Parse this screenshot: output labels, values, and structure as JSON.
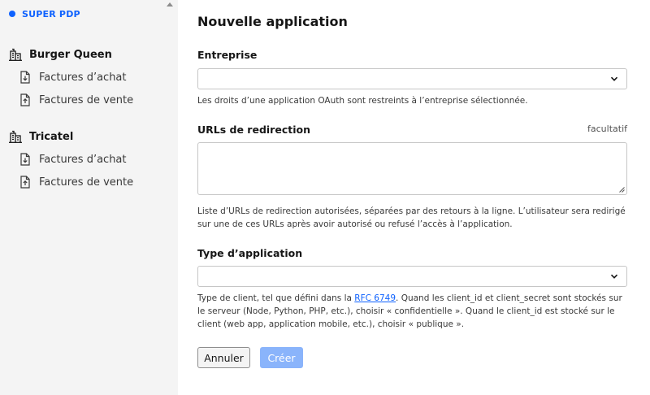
{
  "sidebar": {
    "brand": "SUPER PDP",
    "companies": [
      {
        "name": "Burger Queen",
        "icon": "building-icon",
        "items": [
          {
            "label": "Factures d’achat",
            "icon": "document-download-icon"
          },
          {
            "label": "Factures de vente",
            "icon": "document-upload-icon"
          }
        ]
      },
      {
        "name": "Tricatel",
        "icon": "building-icon",
        "items": [
          {
            "label": "Factures d’achat",
            "icon": "document-download-icon"
          },
          {
            "label": "Factures de vente",
            "icon": "document-upload-icon"
          }
        ]
      }
    ]
  },
  "form": {
    "title": "Nouvelle application",
    "company": {
      "label": "Entreprise",
      "value": "",
      "help": "Les droits d’une application OAuth sont restreints à l’entreprise sélectionnée."
    },
    "redirect_urls": {
      "label": "URLs de redirection",
      "optional": "facultatif",
      "value": "",
      "help": "Liste d’URLs de redirection autorisées, séparées par des retours à la ligne. L’utilisateur sera redirigé sur une de ces URLs après avoir autorisé ou refusé l’accès à l’application."
    },
    "app_type": {
      "label": "Type d’application",
      "value": "",
      "help_before": "Type de client, tel que défini dans la ",
      "help_link": "RFC 6749",
      "help_after": ". Quand les client_id et client_secret sont stockés sur le serveur (Node, Python, PHP, etc.), choisir « confidentielle ». Quand le client_id est stocké sur le client (web app, application mobile, etc.), choisir « publique »."
    },
    "cancel_label": "Annuler",
    "create_label": "Créer"
  },
  "colors": {
    "accent": "#0f62fe",
    "sidebar_bg": "#f4f4f4",
    "disabled_primary": "#8ab4fb"
  }
}
